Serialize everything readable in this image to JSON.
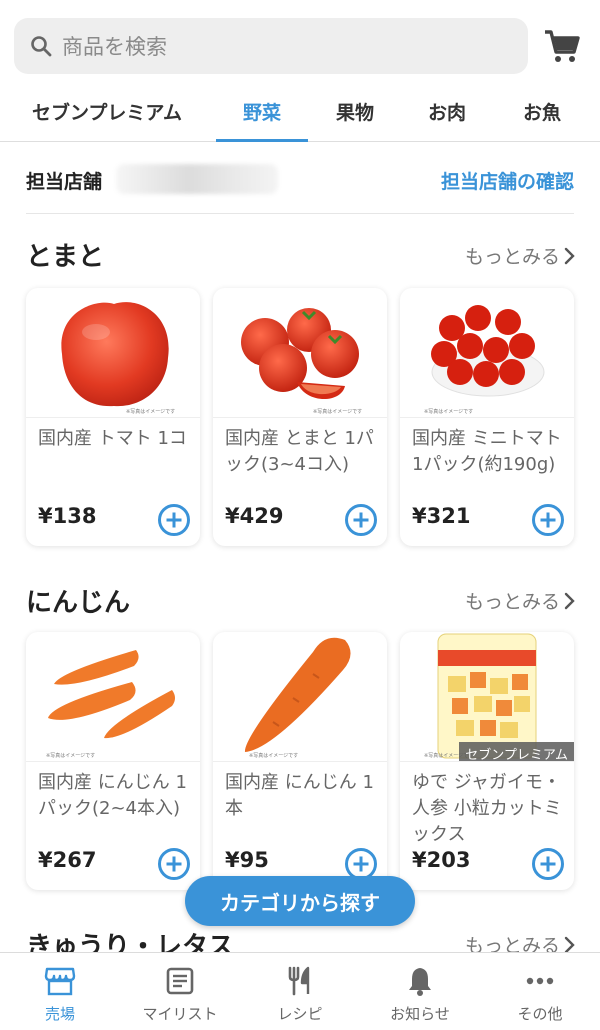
{
  "search": {
    "placeholder": "商品を検索"
  },
  "tabs": [
    {
      "label": "セブンプレミアム"
    },
    {
      "label": "野菜"
    },
    {
      "label": "果物"
    },
    {
      "label": "お肉"
    },
    {
      "label": "お魚"
    }
  ],
  "active_tab": "野菜",
  "store": {
    "label": "担当店舗",
    "confirm_link": "担当店舗の確認"
  },
  "sections": [
    {
      "title": "とまと",
      "more": "もっとみる",
      "products": [
        {
          "name": "国内産 トマト 1コ",
          "price": "¥138",
          "note": "※写真はイメージです"
        },
        {
          "name": "国内産 とまと 1パック(3~4コ入)",
          "price": "¥429",
          "note": "※写真はイメージです"
        },
        {
          "name": "国内産 ミニトマト 1パック(約190g)",
          "price": "¥321",
          "note": "※写真はイメージです"
        }
      ]
    },
    {
      "title": "にんじん",
      "more": "もっとみる",
      "products": [
        {
          "name": "国内産 にんじん 1パック(2~4本入)",
          "price": "¥267",
          "note": "※写真はイメージです"
        },
        {
          "name": "国内産 にんじん 1本",
          "price": "¥95",
          "note": "※写真はイメージです"
        },
        {
          "name": "ゆで ジャガイモ・人参 小粒カットミックス",
          "price": "¥203",
          "note": "※写真はイメージです",
          "badge": "セブンプレミアム"
        }
      ]
    },
    {
      "title": "きゅうり・レタス",
      "more": "もっとみる"
    }
  ],
  "category_button": "カテゴリから探す",
  "bottom_nav": [
    {
      "label": "売場",
      "icon": "store-icon"
    },
    {
      "label": "マイリスト",
      "icon": "list-icon"
    },
    {
      "label": "レシピ",
      "icon": "fork-knife-icon"
    },
    {
      "label": "お知らせ",
      "icon": "bell-icon"
    },
    {
      "label": "その他",
      "icon": "more-dots-icon"
    }
  ],
  "colors": {
    "accent": "#3a93d8",
    "text": "#222222",
    "muted": "#777777"
  }
}
